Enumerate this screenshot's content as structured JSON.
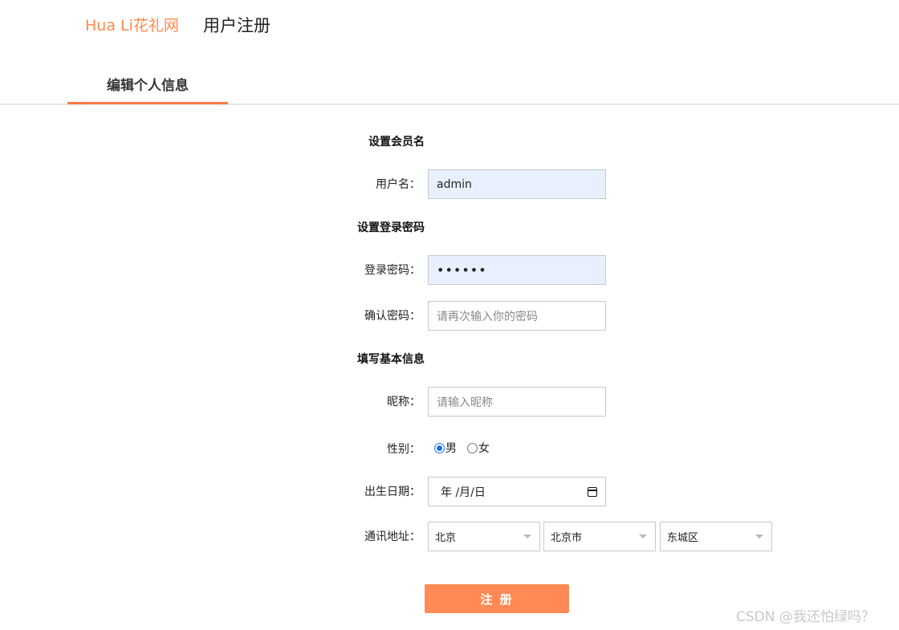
{
  "header": {
    "brand": "Hua Li花礼网",
    "title": "用户注册"
  },
  "tabs": [
    {
      "label": "编辑个人信息",
      "active": true
    }
  ],
  "sections": {
    "member_name": "设置会员名",
    "password": "设置登录密码",
    "basic_info": "填写基本信息"
  },
  "form": {
    "username": {
      "label": "用户名：",
      "value": "admin"
    },
    "login_password": {
      "label": "登录密码：",
      "value": "••••••"
    },
    "confirm_password": {
      "label": "确认密码：",
      "placeholder": "请再次输入你的密码"
    },
    "nickname": {
      "label": "昵称：",
      "placeholder": "请输入昵称"
    },
    "gender": {
      "label": "性别：",
      "options": [
        {
          "label": "男",
          "checked": true
        },
        {
          "label": "女",
          "checked": false
        }
      ]
    },
    "birthday": {
      "label": "出生日期：",
      "value": "年 /月/日"
    },
    "address": {
      "label": "通讯地址：",
      "province": "北京",
      "city": "北京市",
      "district": "东城区"
    }
  },
  "submit_label": "注 册",
  "watermark": "CSDN @我还怕绿吗？",
  "colors": {
    "accent": "#ff8a4c",
    "button": "#ff8a55",
    "autofill": "#e8f0fe",
    "radio": "#1a73e8"
  }
}
